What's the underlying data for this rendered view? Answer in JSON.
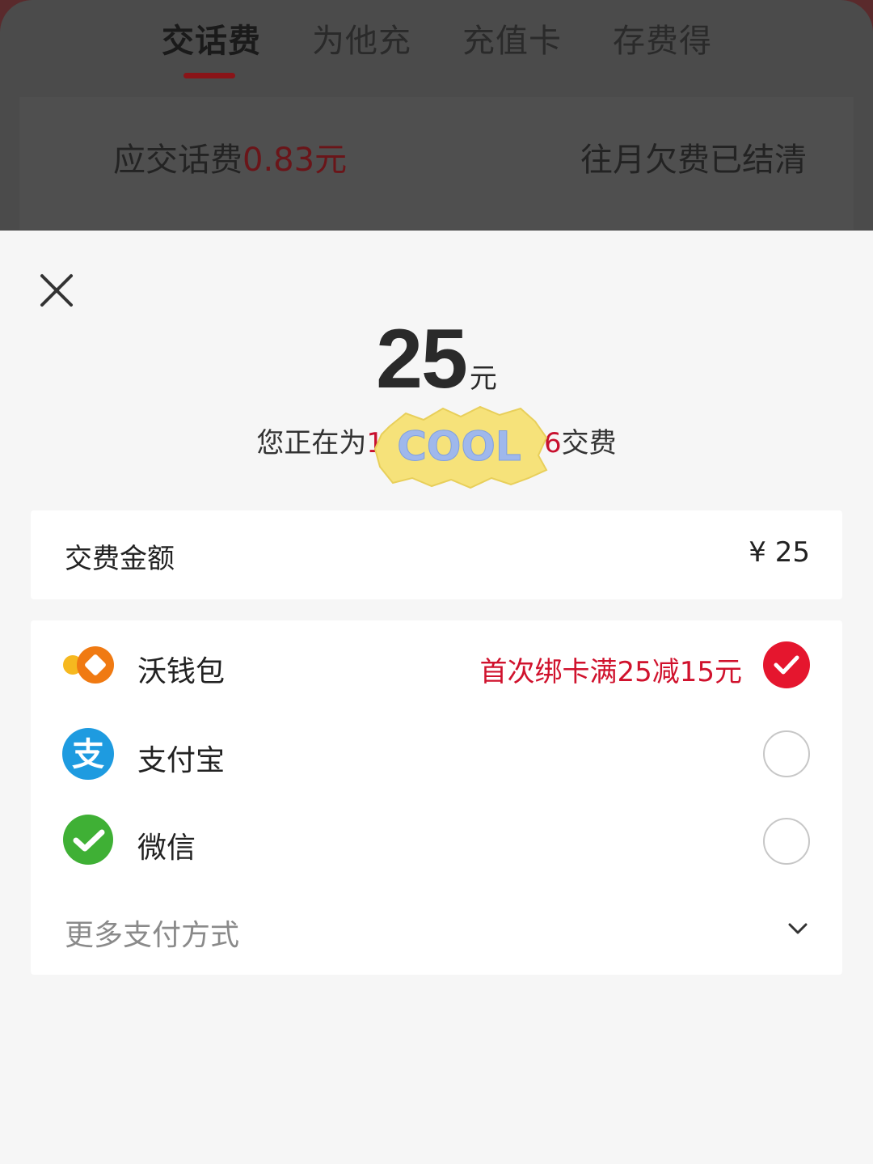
{
  "tabs": [
    {
      "label": "交话费",
      "active": true
    },
    {
      "label": "为他充",
      "active": false
    },
    {
      "label": "充值卡",
      "active": false
    },
    {
      "label": "存费得",
      "active": false
    }
  ],
  "bill": {
    "prefix": "应交话费",
    "amount": "0.83元",
    "status": "往月欠费已结清"
  },
  "sheet": {
    "close_icon": "close-icon",
    "amount_number": "25",
    "amount_unit": "元",
    "paying_prefix": "您正在为",
    "phone_start": "1",
    "phone_end": "6",
    "paying_suffix": "交费",
    "sticker_text": "COOL",
    "fee_label": "交费金额",
    "fee_value": "¥ 25",
    "payment_methods": [
      {
        "name": "沃钱包",
        "icon": "wo-wallet-icon",
        "promo": "首次绑卡满25减15元",
        "selected": true
      },
      {
        "name": "支付宝",
        "icon": "alipay-icon",
        "promo": "",
        "selected": false
      },
      {
        "name": "微信",
        "icon": "wechat-icon",
        "promo": "",
        "selected": false
      }
    ],
    "more_label": "更多支付方式"
  },
  "colors": {
    "accent_red": "#e5162e",
    "promo_red": "#d0122d",
    "alipay_blue": "#1e9be0",
    "wechat_green": "#3fb035",
    "wo_orange": "#f07a12"
  }
}
